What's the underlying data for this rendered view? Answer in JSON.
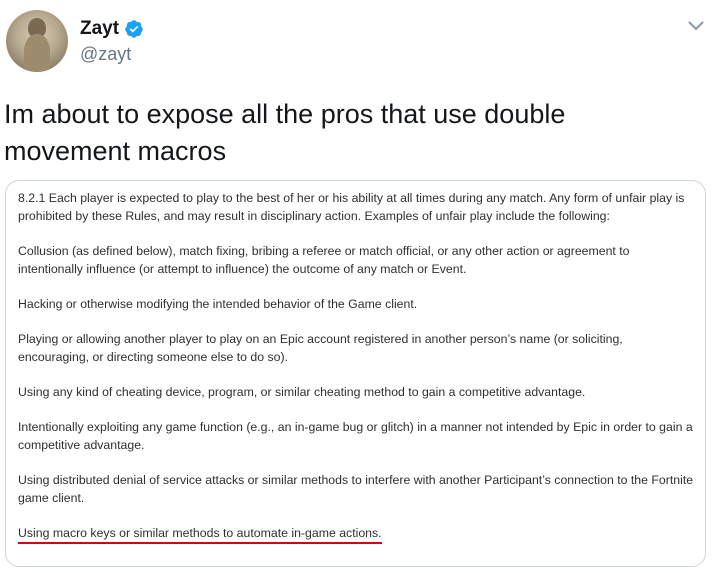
{
  "author": {
    "display_name": "Zayt",
    "handle": "@zayt",
    "verified": true,
    "avatar_icon": "meerkat-avatar"
  },
  "menu_icon": "chevron-down-icon",
  "tweet": {
    "text": "Im about to expose all the pros that use double\nmovement macros"
  },
  "rules": {
    "intro": "8.2.1    Each player is expected to play to the best of her or his ability at all times during any match.  Any form of unfair play is prohibited by these Rules, and may result in disciplinary action.  Examples of unfair play include the following:",
    "items": [
      "Collusion (as defined below), match fixing, bribing a referee or match official, or any other action or agreement to intentionally influence (or attempt to influence) the outcome of any match or Event.",
      "Hacking or otherwise modifying the intended behavior of the Game client.",
      "Playing or allowing another player to play on an Epic account registered in another person’s name (or soliciting, encouraging, or directing someone else to do so).",
      "Using any kind of cheating device, program, or similar cheating method to gain a competitive advantage.",
      "Intentionally exploiting any game function (e.g., an in-game bug or glitch) in a manner not intended by Epic in order to gain a competitive advantage.",
      "Using distributed denial of service attacks or similar methods to interfere with another Participant’s connection to the Fortnite game client.",
      "Using macro keys or similar methods to automate in-game actions."
    ],
    "highlight_color": "#d6001c"
  },
  "colors": {
    "verified_blue": "#1da1f2",
    "secondary_text": "#657786",
    "card_border": "#ccd6dd"
  }
}
